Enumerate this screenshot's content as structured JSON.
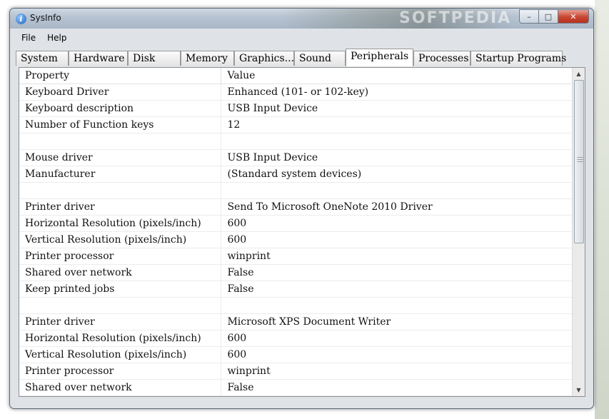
{
  "window": {
    "title": "SysInfo",
    "watermark": "SOFTPEDIA"
  },
  "menu": [
    {
      "label": "File"
    },
    {
      "label": "Help"
    }
  ],
  "tabs": [
    {
      "label": "System",
      "active": false
    },
    {
      "label": "Hardware",
      "active": false
    },
    {
      "label": "Disk",
      "active": false
    },
    {
      "label": "Memory",
      "active": false
    },
    {
      "label": "Graphics...",
      "active": false
    },
    {
      "label": "Sound",
      "active": false
    },
    {
      "label": "Peripherals",
      "active": true
    },
    {
      "label": "Processes",
      "active": false
    },
    {
      "label": "Startup Programs",
      "active": false
    }
  ],
  "table": {
    "columns": [
      "Property",
      "Value"
    ],
    "rows": [
      [
        "Keyboard Driver",
        "Enhanced (101- or 102-key)"
      ],
      [
        "Keyboard description",
        "USB Input Device"
      ],
      [
        "Number of Function keys",
        "12"
      ],
      [
        "",
        ""
      ],
      [
        "Mouse driver",
        "USB Input Device"
      ],
      [
        "Manufacturer",
        "(Standard system devices)"
      ],
      [
        "",
        ""
      ],
      [
        "Printer driver",
        "Send To Microsoft OneNote 2010 Driver"
      ],
      [
        "Horizontal Resolution (pixels/inch)",
        "600"
      ],
      [
        "Vertical Resolution (pixels/inch)",
        "600"
      ],
      [
        "Printer processor",
        "winprint"
      ],
      [
        "Shared over network",
        "False"
      ],
      [
        "Keep printed jobs",
        "False"
      ],
      [
        "",
        ""
      ],
      [
        "Printer driver",
        "Microsoft XPS Document Writer"
      ],
      [
        "Horizontal Resolution (pixels/inch)",
        "600"
      ],
      [
        "Vertical Resolution (pixels/inch)",
        "600"
      ],
      [
        "Printer processor",
        "winprint"
      ],
      [
        "Shared over network",
        "False"
      ]
    ]
  },
  "icons": {
    "app": "info-icon",
    "minimize": "minimize-icon",
    "maximize": "maximize-icon",
    "close": "close-icon",
    "scroll_up": "scroll-up-icon",
    "scroll_down": "scroll-down-icon"
  }
}
